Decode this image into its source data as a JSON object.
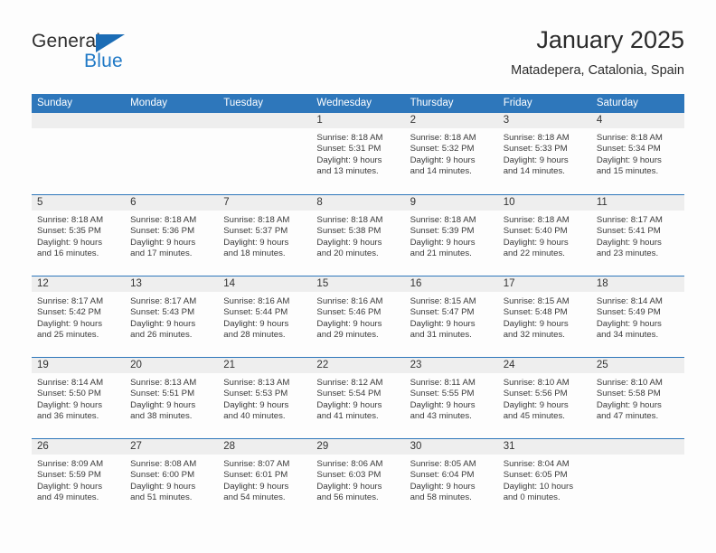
{
  "brand": {
    "name_top": "General",
    "name_bottom": "Blue",
    "triangle_color": "#1b6cb5",
    "blue_text_color": "#2079c6"
  },
  "header": {
    "title": "January 2025",
    "subtitle": "Matadepera, Catalonia, Spain"
  },
  "theme": {
    "header_blue": "#2e77bb",
    "day_number_bg": "#eeeeee",
    "page_bg": "#fdfdfd",
    "text": "#333333"
  },
  "weekdays": [
    "Sunday",
    "Monday",
    "Tuesday",
    "Wednesday",
    "Thursday",
    "Friday",
    "Saturday"
  ],
  "weeks": [
    [
      {
        "day": "",
        "sunrise": "",
        "sunset": "",
        "daylight_line1": "",
        "daylight_line2": ""
      },
      {
        "day": "",
        "sunrise": "",
        "sunset": "",
        "daylight_line1": "",
        "daylight_line2": ""
      },
      {
        "day": "",
        "sunrise": "",
        "sunset": "",
        "daylight_line1": "",
        "daylight_line2": ""
      },
      {
        "day": "1",
        "sunrise": "Sunrise: 8:18 AM",
        "sunset": "Sunset: 5:31 PM",
        "daylight_line1": "Daylight: 9 hours",
        "daylight_line2": "and 13 minutes."
      },
      {
        "day": "2",
        "sunrise": "Sunrise: 8:18 AM",
        "sunset": "Sunset: 5:32 PM",
        "daylight_line1": "Daylight: 9 hours",
        "daylight_line2": "and 14 minutes."
      },
      {
        "day": "3",
        "sunrise": "Sunrise: 8:18 AM",
        "sunset": "Sunset: 5:33 PM",
        "daylight_line1": "Daylight: 9 hours",
        "daylight_line2": "and 14 minutes."
      },
      {
        "day": "4",
        "sunrise": "Sunrise: 8:18 AM",
        "sunset": "Sunset: 5:34 PM",
        "daylight_line1": "Daylight: 9 hours",
        "daylight_line2": "and 15 minutes."
      }
    ],
    [
      {
        "day": "5",
        "sunrise": "Sunrise: 8:18 AM",
        "sunset": "Sunset: 5:35 PM",
        "daylight_line1": "Daylight: 9 hours",
        "daylight_line2": "and 16 minutes."
      },
      {
        "day": "6",
        "sunrise": "Sunrise: 8:18 AM",
        "sunset": "Sunset: 5:36 PM",
        "daylight_line1": "Daylight: 9 hours",
        "daylight_line2": "and 17 minutes."
      },
      {
        "day": "7",
        "sunrise": "Sunrise: 8:18 AM",
        "sunset": "Sunset: 5:37 PM",
        "daylight_line1": "Daylight: 9 hours",
        "daylight_line2": "and 18 minutes."
      },
      {
        "day": "8",
        "sunrise": "Sunrise: 8:18 AM",
        "sunset": "Sunset: 5:38 PM",
        "daylight_line1": "Daylight: 9 hours",
        "daylight_line2": "and 20 minutes."
      },
      {
        "day": "9",
        "sunrise": "Sunrise: 8:18 AM",
        "sunset": "Sunset: 5:39 PM",
        "daylight_line1": "Daylight: 9 hours",
        "daylight_line2": "and 21 minutes."
      },
      {
        "day": "10",
        "sunrise": "Sunrise: 8:18 AM",
        "sunset": "Sunset: 5:40 PM",
        "daylight_line1": "Daylight: 9 hours",
        "daylight_line2": "and 22 minutes."
      },
      {
        "day": "11",
        "sunrise": "Sunrise: 8:17 AM",
        "sunset": "Sunset: 5:41 PM",
        "daylight_line1": "Daylight: 9 hours",
        "daylight_line2": "and 23 minutes."
      }
    ],
    [
      {
        "day": "12",
        "sunrise": "Sunrise: 8:17 AM",
        "sunset": "Sunset: 5:42 PM",
        "daylight_line1": "Daylight: 9 hours",
        "daylight_line2": "and 25 minutes."
      },
      {
        "day": "13",
        "sunrise": "Sunrise: 8:17 AM",
        "sunset": "Sunset: 5:43 PM",
        "daylight_line1": "Daylight: 9 hours",
        "daylight_line2": "and 26 minutes."
      },
      {
        "day": "14",
        "sunrise": "Sunrise: 8:16 AM",
        "sunset": "Sunset: 5:44 PM",
        "daylight_line1": "Daylight: 9 hours",
        "daylight_line2": "and 28 minutes."
      },
      {
        "day": "15",
        "sunrise": "Sunrise: 8:16 AM",
        "sunset": "Sunset: 5:46 PM",
        "daylight_line1": "Daylight: 9 hours",
        "daylight_line2": "and 29 minutes."
      },
      {
        "day": "16",
        "sunrise": "Sunrise: 8:15 AM",
        "sunset": "Sunset: 5:47 PM",
        "daylight_line1": "Daylight: 9 hours",
        "daylight_line2": "and 31 minutes."
      },
      {
        "day": "17",
        "sunrise": "Sunrise: 8:15 AM",
        "sunset": "Sunset: 5:48 PM",
        "daylight_line1": "Daylight: 9 hours",
        "daylight_line2": "and 32 minutes."
      },
      {
        "day": "18",
        "sunrise": "Sunrise: 8:14 AM",
        "sunset": "Sunset: 5:49 PM",
        "daylight_line1": "Daylight: 9 hours",
        "daylight_line2": "and 34 minutes."
      }
    ],
    [
      {
        "day": "19",
        "sunrise": "Sunrise: 8:14 AM",
        "sunset": "Sunset: 5:50 PM",
        "daylight_line1": "Daylight: 9 hours",
        "daylight_line2": "and 36 minutes."
      },
      {
        "day": "20",
        "sunrise": "Sunrise: 8:13 AM",
        "sunset": "Sunset: 5:51 PM",
        "daylight_line1": "Daylight: 9 hours",
        "daylight_line2": "and 38 minutes."
      },
      {
        "day": "21",
        "sunrise": "Sunrise: 8:13 AM",
        "sunset": "Sunset: 5:53 PM",
        "daylight_line1": "Daylight: 9 hours",
        "daylight_line2": "and 40 minutes."
      },
      {
        "day": "22",
        "sunrise": "Sunrise: 8:12 AM",
        "sunset": "Sunset: 5:54 PM",
        "daylight_line1": "Daylight: 9 hours",
        "daylight_line2": "and 41 minutes."
      },
      {
        "day": "23",
        "sunrise": "Sunrise: 8:11 AM",
        "sunset": "Sunset: 5:55 PM",
        "daylight_line1": "Daylight: 9 hours",
        "daylight_line2": "and 43 minutes."
      },
      {
        "day": "24",
        "sunrise": "Sunrise: 8:10 AM",
        "sunset": "Sunset: 5:56 PM",
        "daylight_line1": "Daylight: 9 hours",
        "daylight_line2": "and 45 minutes."
      },
      {
        "day": "25",
        "sunrise": "Sunrise: 8:10 AM",
        "sunset": "Sunset: 5:58 PM",
        "daylight_line1": "Daylight: 9 hours",
        "daylight_line2": "and 47 minutes."
      }
    ],
    [
      {
        "day": "26",
        "sunrise": "Sunrise: 8:09 AM",
        "sunset": "Sunset: 5:59 PM",
        "daylight_line1": "Daylight: 9 hours",
        "daylight_line2": "and 49 minutes."
      },
      {
        "day": "27",
        "sunrise": "Sunrise: 8:08 AM",
        "sunset": "Sunset: 6:00 PM",
        "daylight_line1": "Daylight: 9 hours",
        "daylight_line2": "and 51 minutes."
      },
      {
        "day": "28",
        "sunrise": "Sunrise: 8:07 AM",
        "sunset": "Sunset: 6:01 PM",
        "daylight_line1": "Daylight: 9 hours",
        "daylight_line2": "and 54 minutes."
      },
      {
        "day": "29",
        "sunrise": "Sunrise: 8:06 AM",
        "sunset": "Sunset: 6:03 PM",
        "daylight_line1": "Daylight: 9 hours",
        "daylight_line2": "and 56 minutes."
      },
      {
        "day": "30",
        "sunrise": "Sunrise: 8:05 AM",
        "sunset": "Sunset: 6:04 PM",
        "daylight_line1": "Daylight: 9 hours",
        "daylight_line2": "and 58 minutes."
      },
      {
        "day": "31",
        "sunrise": "Sunrise: 8:04 AM",
        "sunset": "Sunset: 6:05 PM",
        "daylight_line1": "Daylight: 10 hours",
        "daylight_line2": "and 0 minutes."
      },
      {
        "day": "",
        "sunrise": "",
        "sunset": "",
        "daylight_line1": "",
        "daylight_line2": ""
      }
    ]
  ]
}
